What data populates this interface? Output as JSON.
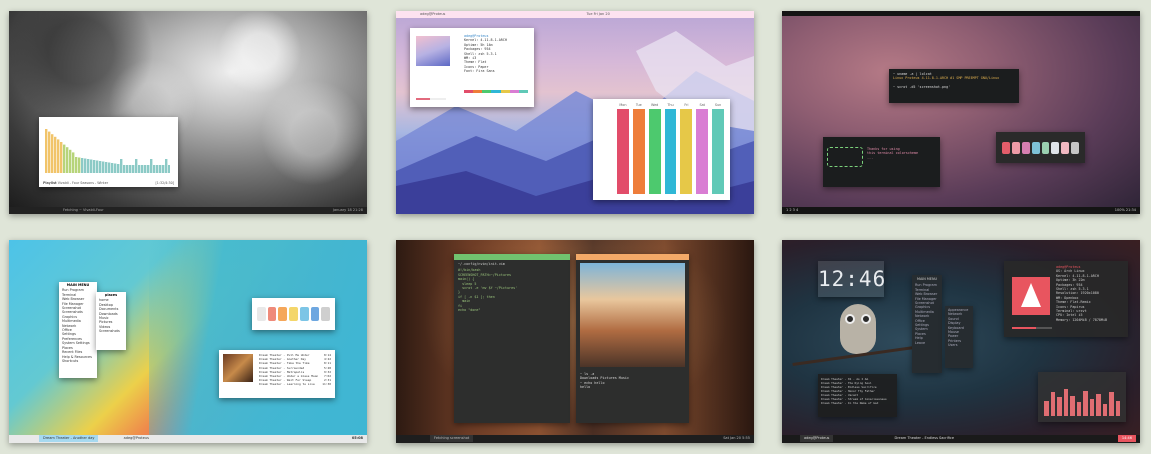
{
  "shots": {
    "s1": {
      "audio_title": "Playlist",
      "audio_sub": "Vivaldi - Four Seasons - Winter",
      "audio_time": "[1:32/4:30]",
      "panel_left": "Fetching ~ Vivaldi-Four",
      "panel_right": "January 18 21:28"
    },
    "s2": {
      "top_left": "adeg@Proteus",
      "top_mid": "Tue  Fri Jan 20",
      "fetch_user": "adeg@Proteus",
      "fetch_lines": [
        "Kernel: 4.11.8-1-ARCH",
        "Uptime: 5h 14m",
        "Packages: 954",
        "Shell: zsh 5.3.1",
        "WM: i3",
        "Theme: Flat",
        "Icons: Paper",
        "Font: Fira Sans"
      ],
      "cal_days": [
        "Mon",
        "Tue",
        "Wed",
        "Thu",
        "Fri",
        "Sat",
        "Sun"
      ],
      "cal_colors": [
        "#e24d6a",
        "#ee7d3a",
        "#4dc96e",
        "#2fb7d6",
        "#e6c848",
        "#d97dd3",
        "#60c9b7"
      ]
    },
    "s3": {
      "term_prompt": "~ uname -a | lolcat",
      "term_line": "Linux Proteus 4.11.8-1-ARCH #1 SMP PREEMPT GNU/Linux",
      "term_prompt2": "~ scrot -d5 'screenshot.png'",
      "figlet_lines": [
        "Thanks for using",
        "this terminal colorscheme",
        "..."
      ],
      "palette": [
        "#e35d6a",
        "#ee9ba7",
        "#d77fb1",
        "#7ec2d7",
        "#9ad0b0",
        "#dfe3e8",
        "#f1b8c1",
        "#c6c6c6"
      ],
      "panel_left": "1  2  3  4",
      "panel_right": "100%   21:34"
    },
    "s4": {
      "menu_title": "MAIN MENU",
      "menu_items": [
        "Run Program",
        "Terminal",
        "Web Browser",
        "File Manager",
        "Screenshot",
        "Screenshots",
        "Graphics",
        "Multimedia",
        "Network",
        "Office",
        "Settings",
        "Preferences",
        "System Settings",
        "Places",
        "Recent Files",
        "Help & Resources",
        "Shortcuts"
      ],
      "sub_title": "places",
      "sub_items": [
        "home",
        "Desktop",
        "Documents",
        "Downloads",
        "Music",
        "Pictures",
        "Videos",
        "Screenshots"
      ],
      "palette": [
        "#e8e8e8",
        "#ef8a7a",
        "#f5a75a",
        "#f4d66a",
        "#7cc5e6",
        "#6ea7e0",
        "#cfcfcf"
      ],
      "tracks": [
        "Dream Theater - Pull Me Under",
        "Dream Theater - Another Day",
        "Dream Theater - Take the Time",
        "Dream Theater - Surrounded",
        "Dream Theater - Metropolis",
        "Dream Theater - Under a Glass Moon",
        "Dream Theater - Wait For Sleep",
        "Dream Theater - Learning to Live"
      ],
      "track_times": [
        "8:14",
        "4:22",
        "8:11",
        "5:28",
        "9:32",
        "7:02",
        "2:31",
        "11:30"
      ],
      "panel_task1": "Dream Theater - Another day",
      "panel_task2": "adeg@Proteus",
      "panel_clock": "05:08"
    },
    "s5": {
      "code_title": "~/.config/nvim/init.vim",
      "code_lines": [
        "#!/bin/bash",
        "",
        "SCREENSHOT_PATH=~/Pictures",
        "",
        "main() {",
        "  sleep 5",
        "  scrot -e 'mv $f ~/Pictures'",
        "}",
        "",
        "if [ -n $1 ]; then",
        "  main",
        "fi",
        "",
        "echo \"done\""
      ],
      "img_caption": "~ cd",
      "term_lines": [
        "~ ls -a",
        "Downloads  Pictures  Music",
        "~ echo hello",
        "hello"
      ],
      "panel_task": "Fetching screenshot",
      "panel_right": "Sat Jan 20  5:55"
    },
    "s6": {
      "clock": "12:46",
      "menu_title": "MAIN MENU",
      "menu_items": [
        "Run Program",
        "Terminal",
        "Web Browser",
        "File Manager",
        "Screenshot",
        "Graphics",
        "Multimedia",
        "Network",
        "Office",
        "Settings",
        "System",
        "Places",
        "Help",
        "Leave"
      ],
      "sub_items": [
        "Appearance",
        "Network",
        "Sound",
        "Display",
        "Keyboard",
        "Mouse",
        "Power",
        "Printers",
        "Users"
      ],
      "fetch_user": "adeg@Proteus",
      "fetch_lines": [
        "OS: Arch Linux",
        "Kernel: 4.11.8-1-ARCH",
        "Uptime: 3h 22m",
        "Packages: 954",
        "Shell: zsh 5.3.1",
        "Resolution: 1920x1080",
        "WM: Openbox",
        "Theme: Flat-Remix",
        "Icons: Papirus",
        "Terminal: urxvt",
        "CPU: Intel i5",
        "Memory: 1204MiB / 7878MiB"
      ],
      "music_lines": [
        "Dream Theater - 01 - As I Am",
        "Dream Theater - The Dying Soul",
        "Dream Theater - Endless Sacrifice",
        "Dream Theater - Honor Thy Father",
        "Dream Theater - Vacant",
        "Dream Theater - Stream of Consciousness",
        "Dream Theater - In the Name of God"
      ],
      "viz_levels": [
        0.45,
        0.7,
        0.55,
        0.8,
        0.6,
        0.4,
        0.75,
        0.5,
        0.65,
        0.35,
        0.7,
        0.45
      ],
      "panel_left": "adeg@Proteus",
      "panel_mid": "Dream Theater - Endless Sacrifice",
      "panel_right": "14:46"
    }
  }
}
